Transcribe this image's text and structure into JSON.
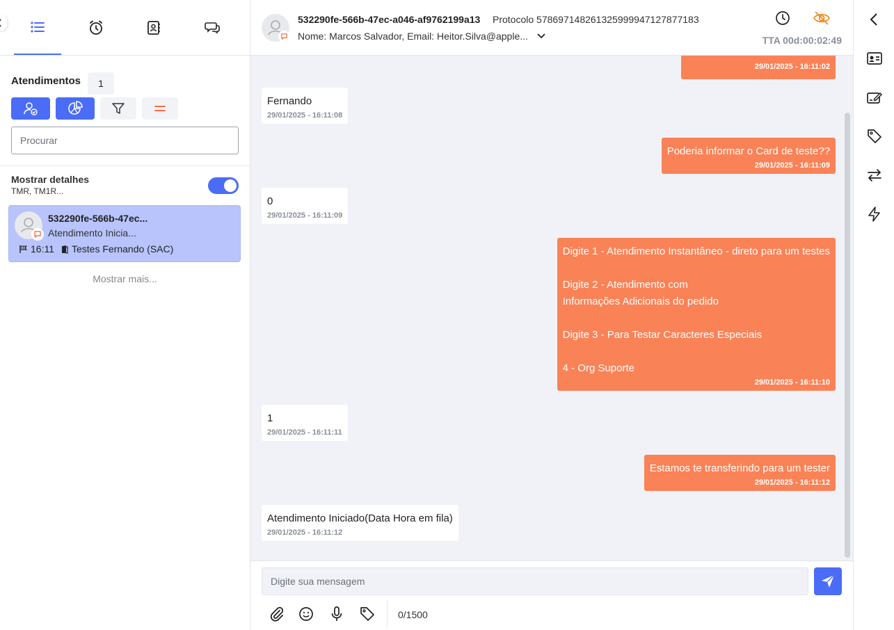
{
  "sidebar": {
    "section_title": "Atendimentos",
    "count": "1",
    "search_placeholder": "Procurar",
    "details_label": "Mostrar detalhes",
    "details_sub": "TMR, TM1R...",
    "show_more": "Mostrar mais...",
    "card": {
      "title": "532290fe-566b-47ec...",
      "subtitle": "Atendimento Inicia...",
      "time": "16:11",
      "queue": "Testes Fernando (SAC)"
    }
  },
  "header": {
    "id": "532290fe-566b-47ec-a046-af9762199a13",
    "protocol": "Protocolo 578697148261325999947127877183",
    "name_line": "Nome: Marcos Salvador, Email: Heitor.Silva@apple...",
    "tta": "TTA 00d:00:02:49"
  },
  "messages": [
    {
      "dir": "out",
      "text": "",
      "time": "29/01/2025 - 16:11:02"
    },
    {
      "dir": "in",
      "text": "Fernando",
      "time": "29/01/2025 - 16:11:08"
    },
    {
      "dir": "out",
      "text": "Poderia informar o Card de teste??",
      "time": "29/01/2025 - 16:11:09"
    },
    {
      "dir": "in",
      "text": "0",
      "time": "29/01/2025 - 16:11:09"
    },
    {
      "dir": "out",
      "text": "Digite 1 - Atendimento Instantâneo - direto para um testes\n\nDigite 2 - Atendimento com\nInformações Adicionais do pedido\n\nDigite 3 - Para Testar Caracteres Especiais\n\n4 - Org Suporte",
      "time": "29/01/2025 - 16:11:10"
    },
    {
      "dir": "in",
      "text": "1",
      "time": "29/01/2025 - 16:11:11"
    },
    {
      "dir": "out",
      "text": "Estamos te transferindo para um tester",
      "time": "29/01/2025 - 16:11:12"
    },
    {
      "dir": "in",
      "text": "Atendimento Iniciado(Data Hora em fila)",
      "time": "29/01/2025 - 16:11:12"
    }
  ],
  "composer": {
    "placeholder": "Digite sua mensagem",
    "char_count": "0/1500"
  },
  "colors": {
    "accent": "#4a6cf7",
    "outgoing": "#fa8257",
    "chat_bg": "#f0f2f7"
  }
}
